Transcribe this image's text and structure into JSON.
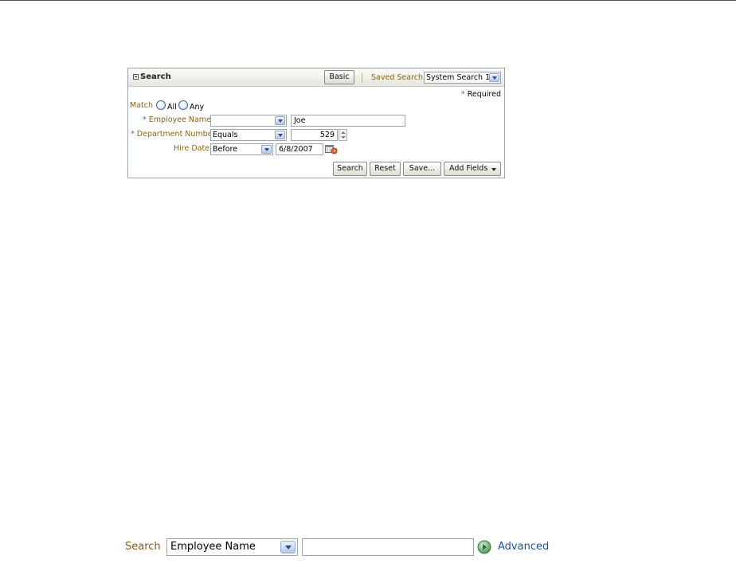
{
  "panel": {
    "title": "Search",
    "basic_label": "Basic",
    "saved_search_label": "Saved Search",
    "saved_search_value": "System Search 1",
    "required_star": "*",
    "required_note": "Required"
  },
  "match": {
    "label": "Match",
    "options": [
      {
        "label": "All",
        "selected": false
      },
      {
        "label": "Any",
        "selected": false
      }
    ]
  },
  "fields": [
    {
      "label": "Employee Name",
      "required": true,
      "operator": "",
      "value": "Joe"
    },
    {
      "label": "Department Number",
      "required": true,
      "operator": "Equals",
      "value": "529"
    },
    {
      "label": "Hire Date",
      "required": false,
      "operator": "Before",
      "value": "6/8/2007"
    }
  ],
  "actions": {
    "search": "Search",
    "reset": "Reset",
    "save": "Save...",
    "add_fields": "Add Fields"
  },
  "simple_search": {
    "label": "Search",
    "field_value": "Employee Name",
    "input_value": "",
    "advanced_label": "Advanced"
  },
  "colors": {
    "label_brown": "#8a6314",
    "required_blue": "#3a6cb4",
    "link_blue": "#1d4e9c"
  },
  "icons": [
    "collapse-icon",
    "dropdown-arrow-icon",
    "spinner-icon",
    "calendar-icon",
    "go-arrow-icon",
    "menu-arrow-icon"
  ]
}
